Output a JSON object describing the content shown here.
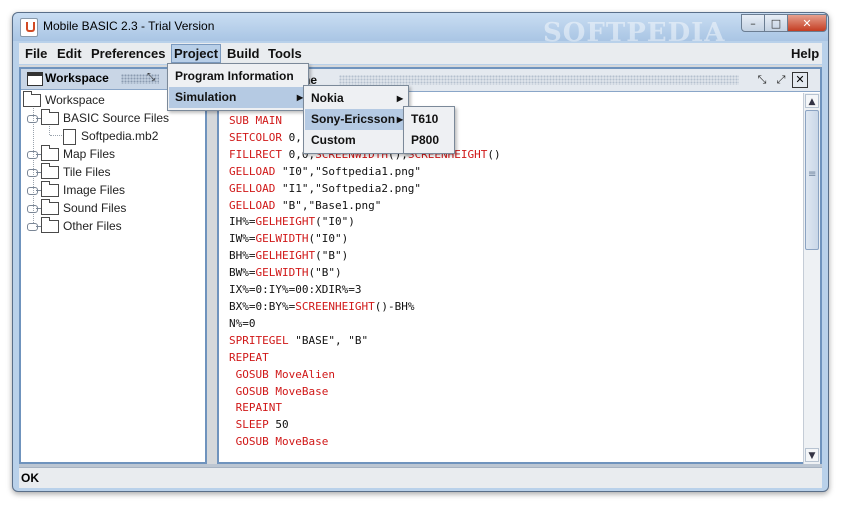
{
  "window": {
    "title": "Mobile BASIC 2.3 - Trial Version",
    "watermark": "SOFTPEDIA",
    "controls": {
      "minimize": "–",
      "maximize": "□",
      "close": "✕"
    }
  },
  "menubar": {
    "items": [
      {
        "label": "File"
      },
      {
        "label": "Edit"
      },
      {
        "label": "Preferences"
      },
      {
        "label": "Project"
      },
      {
        "label": "Build"
      },
      {
        "label": "Tools"
      }
    ],
    "help": "Help"
  },
  "workspace": {
    "title": "Workspace",
    "tree": {
      "root": "Workspace",
      "basic_source": "BASIC Source Files",
      "file1": "Softpedia.mb2",
      "map": "Map Files",
      "tile": "Tile Files",
      "image": "Image Files",
      "sound": "Sound Files",
      "other": "Other Files"
    }
  },
  "editor": {
    "title_fragment": "ne",
    "code_lines": [
      "SUB MAIN",
      "SETCOLOR 0,",
      "FILLRECT 0,0,SCREENWIDTH(),SCREENHEIGHT()",
      "GELLOAD \"I0\",\"Softpedia1.png\"",
      "GELLOAD \"I1\",\"Softpedia2.png\"",
      "GELLOAD \"B\",\"Base1.png\"",
      "IH%=GELHEIGHT(\"I0\")",
      "IW%=GELWIDTH(\"I0\")",
      "BH%=GELHEIGHT(\"B\")",
      "BW%=GELWIDTH(\"B\")",
      "IX%=0:IY%=00:XDIR%=3",
      "BX%=0:BY%=SCREENHEIGHT()-BH%",
      "N%=0",
      "SPRITEGEL \"BASE\", \"B\"",
      "REPEAT",
      " GOSUB MoveAlien",
      " GOSUB MoveBase",
      " REPAINT",
      " SLEEP 50",
      " GOSUB MoveBase"
    ]
  },
  "project_menu": {
    "program_information": "Program Information",
    "simulation": "Simulation"
  },
  "simulation_menu": {
    "nokia": "Nokia",
    "sony_ericsson": "Sony-Ericsson",
    "custom": "Custom"
  },
  "sony_menu": {
    "t610": "T610",
    "p800": "P800"
  },
  "status": {
    "text": "OK"
  }
}
